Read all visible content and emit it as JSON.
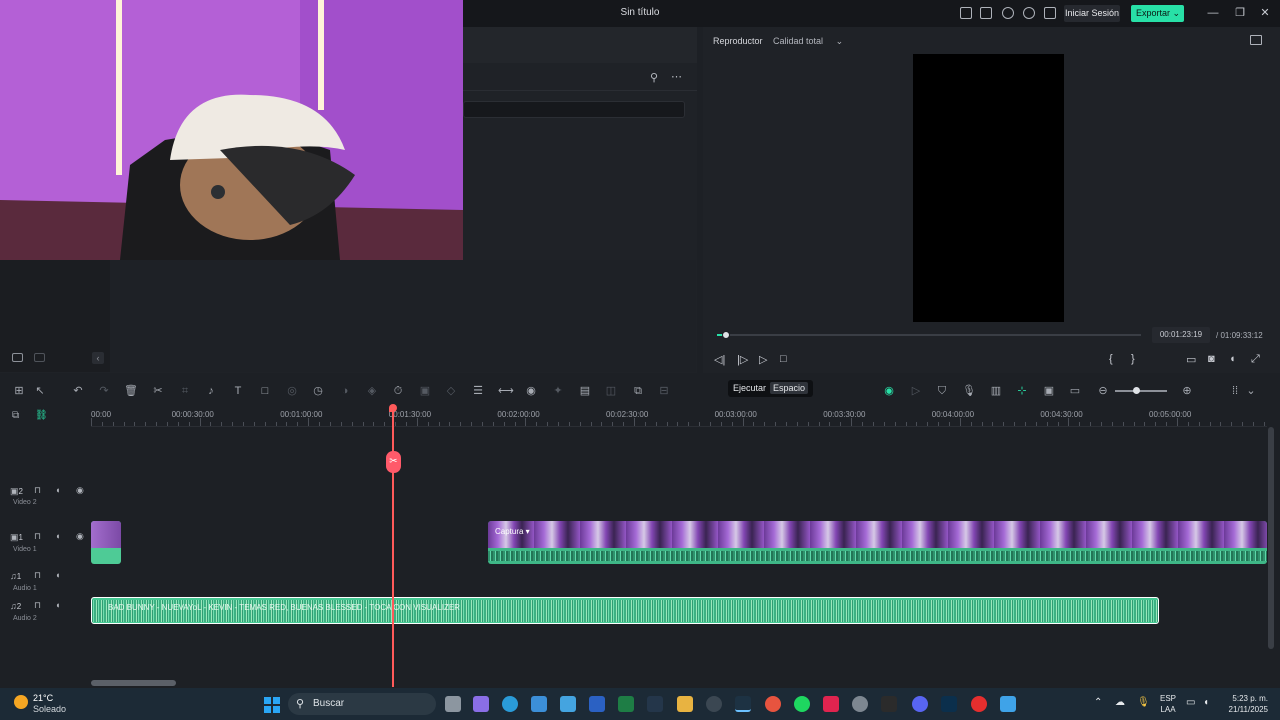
{
  "window": {
    "title": "Sin título",
    "login_label": "Iniciar Sesión",
    "export_label": "Exportar"
  },
  "player": {
    "label": "Reproductor",
    "quality": "Calidad total",
    "current_time": "00:01:23:19",
    "total_time": "/ 01:09:33:12",
    "progress_fraction": 0.02
  },
  "tooltip": {
    "action": "Ejecutar",
    "shortcut": "Espacio"
  },
  "ruler": {
    "ticks": [
      "00:00",
      "00:00:30:00",
      "00:01:00:00",
      "00:01:30:00",
      "00:02:00:00",
      "00:02:30:00",
      "00:03:00:00",
      "00:03:30:00",
      "00:04:00:00",
      "00:04:30:00",
      "00:05:00:00"
    ]
  },
  "tracks": [
    {
      "num": "2",
      "name": "Video 2"
    },
    {
      "num": "1",
      "name": "Video 1"
    },
    {
      "num": "1",
      "name": "Audio 1"
    },
    {
      "num": "2",
      "name": "Audio 2"
    }
  ],
  "clips": {
    "video1_name": "Captura ▾",
    "audio2_name": "BAD BUNNY - NUEVAYoL - KEVIN - TEMAS RED, BUENAS BLESSED - TOCA CON VISUALIZER"
  },
  "taskbar": {
    "weather_temp": "21°C",
    "weather_desc": "Soleado",
    "search_placeholder": "Buscar",
    "lang_top": "ESP",
    "lang_bottom": "LAA",
    "time": "5:23 p. m.",
    "date": "21/11/2025"
  },
  "colors": {
    "accent": "#28e0a7",
    "playhead": "#ff5a5a",
    "clip_audio": "#45c893"
  }
}
